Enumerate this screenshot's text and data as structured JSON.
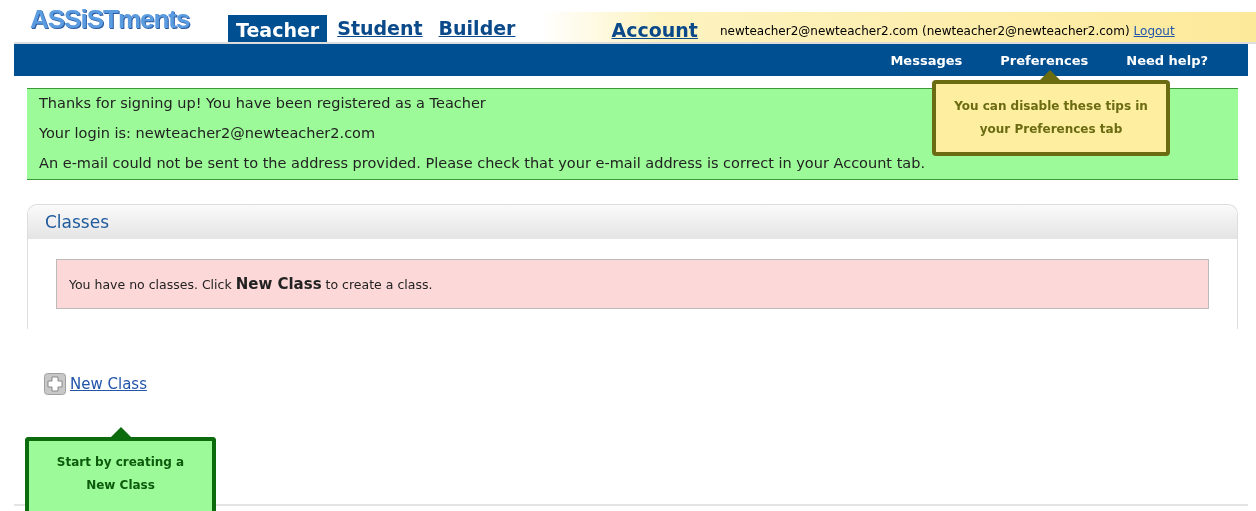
{
  "logo": "ASSiSTments",
  "tabs": [
    {
      "label": "Teacher",
      "selected": true
    },
    {
      "label": "Student",
      "selected": false
    },
    {
      "label": "Builder",
      "selected": false
    }
  ],
  "account_tab": {
    "label": "Account"
  },
  "user": {
    "text": "newteacher2@newteacher2.com (newteacher2@newteacher2.com)",
    "logout": "Logout"
  },
  "nav": [
    "Messages",
    "Preferences",
    "Need help?"
  ],
  "notice": [
    "Thanks for signing up! You have been registered as a Teacher",
    "Your login is: newteacher2@newteacher2.com",
    "An e-mail could not be sent to the address provided. Please check that your e-mail address is correct in your Account tab."
  ],
  "classes": {
    "title": "Classes",
    "empty_message": "You have no classes. Click **New Class** to create a class."
  },
  "new_class": {
    "label": "New Class"
  },
  "tips": [
    {
      "text": "You can disable these tips in your Preferences tab",
      "kind": "yellow"
    },
    {
      "text": "Start by creating a New Class",
      "kind": "green"
    }
  ]
}
